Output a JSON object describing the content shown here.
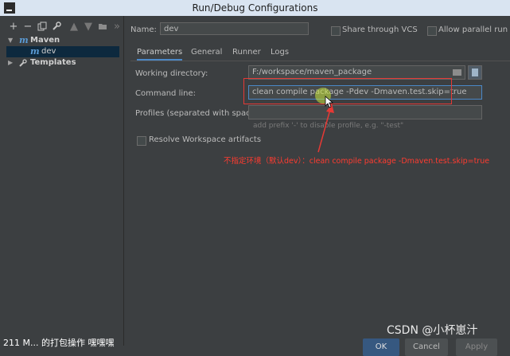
{
  "window": {
    "title": "Run/Debug Configurations"
  },
  "toolbar": {
    "buttons": [
      "add",
      "remove",
      "copy",
      "edit-templates",
      "move-up",
      "move-down",
      "folder",
      "sort"
    ],
    "more_label": "»"
  },
  "tree": {
    "maven": {
      "icon": "m",
      "label": "Maven"
    },
    "dev": {
      "icon": "m",
      "label": "dev"
    },
    "templates": {
      "label": "Templates"
    }
  },
  "name": {
    "label": "Name:",
    "value": "dev"
  },
  "share": {
    "label": "Share through VCS"
  },
  "parallel": {
    "label": "Allow parallel run"
  },
  "tabs": [
    "Parameters",
    "General",
    "Runner",
    "Logs"
  ],
  "form": {
    "working_dir": {
      "label": "Working directory:",
      "value": "F:/workspace/maven_package"
    },
    "command_line": {
      "label": "Command line:",
      "value": "clean compile package -Pdev -Dmaven.test.skip=true"
    },
    "profiles": {
      "label": "Profiles (separated with space):",
      "value": "",
      "hint": "add prefix '-' to disable profile, e.g. \"-test\""
    },
    "resolve": {
      "label": "Resolve Workspace artifacts"
    }
  },
  "annotation": {
    "text": "不指定环境（默认dev）：clean compile package  -Dmaven.test.skip=true",
    "color": "#ff3b30"
  },
  "watermark": "CSDN @小杯崽汁",
  "buttons": {
    "ok": "OK",
    "cancel": "Cancel",
    "apply": "Apply"
  },
  "taskbar": {
    "text": "211 M... 的打包操作 嘿嘿嘿"
  },
  "colors": {
    "accent": "#4a88c7",
    "selection": "#0d293e",
    "background": "#3c3f41"
  }
}
